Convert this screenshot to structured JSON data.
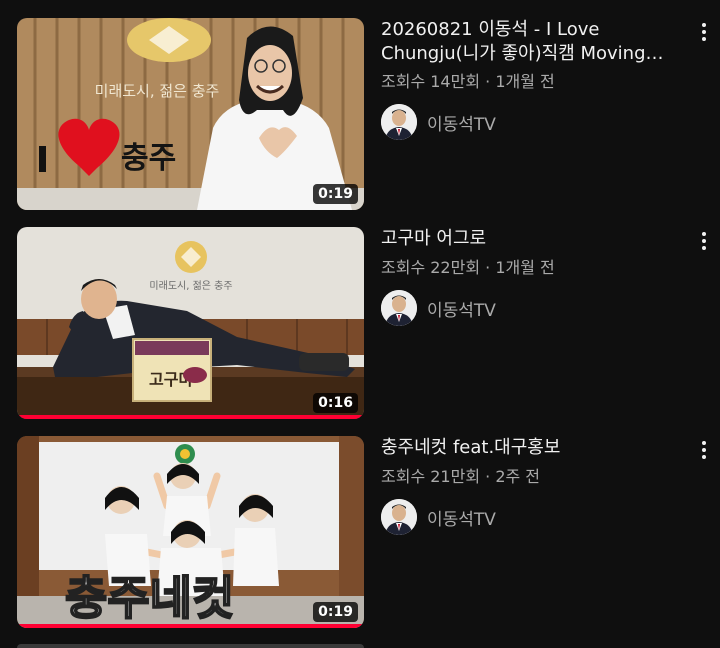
{
  "videos": [
    {
      "title": "20260821 이동석 - I Love Chungju(니가 좋아)직캠 Moving st…",
      "views": "조회수 14만회",
      "age": "1개월 전",
      "channel": "이동석TV",
      "duration": "0:19",
      "watched_fraction": 0,
      "thumb_text": "I ♥ 충주",
      "thumb_sign": "미래도시, 젊은 충주"
    },
    {
      "title": "고구마 어그로",
      "views": "조회수 22만회",
      "age": "1개월 전",
      "channel": "이동석TV",
      "duration": "0:16",
      "watched_fraction": 1.0,
      "thumb_box_text": "고구마",
      "thumb_sign": "미래도시, 젊은 충주"
    },
    {
      "title": "충주네컷 feat.대구홍보",
      "views": "조회수 21만회",
      "age": "2주 전",
      "channel": "이동석TV",
      "duration": "0:19",
      "watched_fraction": 1.0,
      "thumb_text": "충주네컷"
    }
  ],
  "separator": "·",
  "icons": {
    "menu": "more-vert-icon"
  },
  "colors": {
    "background": "#0f0f0f",
    "progress": "#ff0033",
    "secondary_text": "#aaaaaa"
  }
}
